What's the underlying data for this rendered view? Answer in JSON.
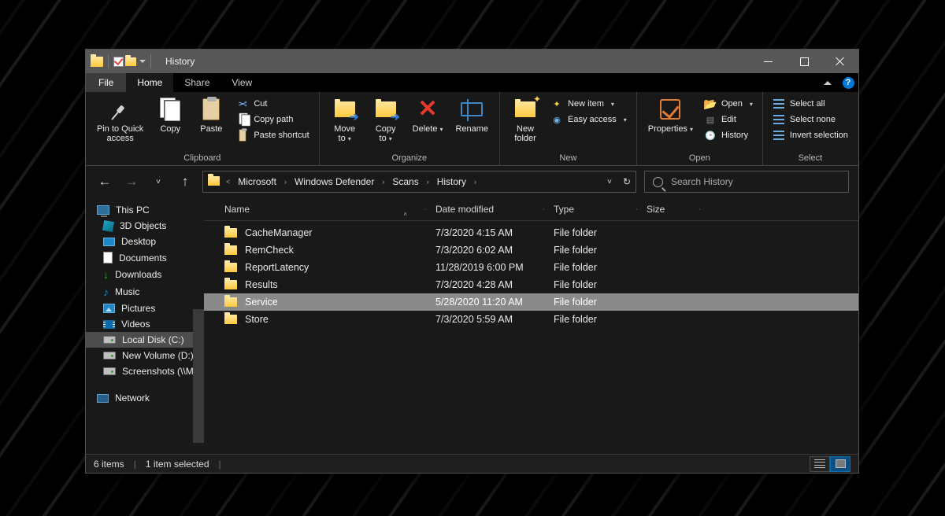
{
  "window": {
    "title": "History"
  },
  "menu": {
    "file": "File",
    "tabs": [
      "Home",
      "Share",
      "View"
    ],
    "active": 0
  },
  "ribbon": {
    "clipboard": {
      "label": "Clipboard",
      "pin": "Pin to Quick\naccess",
      "copy": "Copy",
      "paste": "Paste",
      "cut": "Cut",
      "copypath": "Copy path",
      "pasteshort": "Paste shortcut"
    },
    "organize": {
      "label": "Organize",
      "moveto": "Move\nto",
      "copyto": "Copy\nto",
      "delete": "Delete",
      "rename": "Rename"
    },
    "new": {
      "label": "New",
      "newfolder": "New\nfolder",
      "newitem": "New item",
      "easyaccess": "Easy access"
    },
    "open": {
      "label": "Open",
      "properties": "Properties",
      "open": "Open",
      "edit": "Edit",
      "history": "History"
    },
    "select": {
      "label": "Select",
      "all": "Select all",
      "none": "Select none",
      "invert": "Invert selection"
    }
  },
  "breadcrumb": [
    "Microsoft",
    "Windows Defender",
    "Scans",
    "History"
  ],
  "search": {
    "placeholder": "Search History"
  },
  "sidebar": {
    "thispc": "This PC",
    "items": [
      "3D Objects",
      "Desktop",
      "Documents",
      "Downloads",
      "Music",
      "Pictures",
      "Videos",
      "Local Disk (C:)",
      "New Volume (D:)",
      "Screenshots (\\\\M"
    ],
    "network": "Network",
    "selected": 7
  },
  "columns": {
    "name": "Name",
    "date": "Date modified",
    "type": "Type",
    "size": "Size"
  },
  "rows": [
    {
      "name": "CacheManager",
      "date": "7/3/2020 4:15 AM",
      "type": "File folder"
    },
    {
      "name": "RemCheck",
      "date": "7/3/2020 6:02 AM",
      "type": "File folder"
    },
    {
      "name": "ReportLatency",
      "date": "11/28/2019 6:00 PM",
      "type": "File folder"
    },
    {
      "name": "Results",
      "date": "7/3/2020 4:28 AM",
      "type": "File folder"
    },
    {
      "name": "Service",
      "date": "5/28/2020 11:20 AM",
      "type": "File folder",
      "selected": true
    },
    {
      "name": "Store",
      "date": "7/3/2020 5:59 AM",
      "type": "File folder"
    }
  ],
  "status": {
    "count": "6 items",
    "selected": "1 item selected"
  }
}
